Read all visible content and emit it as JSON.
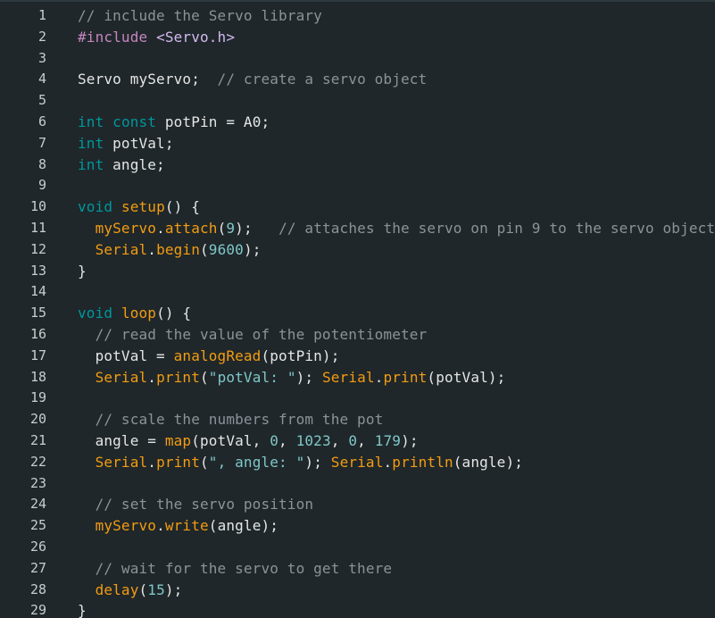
{
  "editor": {
    "lines": [
      {
        "n": "1",
        "tokens": [
          {
            "t": "// include the Servo library",
            "c": "comment"
          }
        ]
      },
      {
        "n": "2",
        "tokens": [
          {
            "t": "#include",
            "c": "pre"
          },
          {
            "t": " ",
            "c": "plain"
          },
          {
            "t": "<Servo.h>",
            "c": "hdr"
          }
        ]
      },
      {
        "n": "3",
        "tokens": []
      },
      {
        "n": "4",
        "tokens": [
          {
            "t": "Servo myServ",
            "c": "plain"
          },
          {
            "t": "o;  ",
            "c": "plain"
          },
          {
            "t": "// create a servo object",
            "c": "comment"
          }
        ]
      },
      {
        "n": "5",
        "tokens": []
      },
      {
        "n": "6",
        "tokens": [
          {
            "t": "int",
            "c": "type"
          },
          {
            "t": " ",
            "c": "plain"
          },
          {
            "t": "const",
            "c": "type"
          },
          {
            "t": " potPin = A0;",
            "c": "plain"
          }
        ]
      },
      {
        "n": "7",
        "tokens": [
          {
            "t": "int",
            "c": "type"
          },
          {
            "t": " potVal;",
            "c": "plain"
          }
        ]
      },
      {
        "n": "8",
        "tokens": [
          {
            "t": "int",
            "c": "type"
          },
          {
            "t": " angle;",
            "c": "plain"
          }
        ]
      },
      {
        "n": "9",
        "tokens": []
      },
      {
        "n": "10",
        "tokens": [
          {
            "t": "void",
            "c": "type"
          },
          {
            "t": " ",
            "c": "plain"
          },
          {
            "t": "setup",
            "c": "fn"
          },
          {
            "t": "() {",
            "c": "plain"
          }
        ]
      },
      {
        "n": "11",
        "tokens": [
          {
            "t": "  ",
            "c": "plain"
          },
          {
            "t": "myServo",
            "c": "fn"
          },
          {
            "t": ".",
            "c": "plain"
          },
          {
            "t": "attach",
            "c": "fn"
          },
          {
            "t": "(",
            "c": "plain"
          },
          {
            "t": "9",
            "c": "num"
          },
          {
            "t": ");   ",
            "c": "plain"
          },
          {
            "t": "// attaches the servo on pin 9 to the servo object",
            "c": "comment"
          }
        ]
      },
      {
        "n": "12",
        "tokens": [
          {
            "t": "  ",
            "c": "plain"
          },
          {
            "t": "Serial",
            "c": "fn"
          },
          {
            "t": ".",
            "c": "plain"
          },
          {
            "t": "begin",
            "c": "fn"
          },
          {
            "t": "(",
            "c": "plain"
          },
          {
            "t": "9600",
            "c": "num"
          },
          {
            "t": ");",
            "c": "plain"
          }
        ]
      },
      {
        "n": "13",
        "tokens": [
          {
            "t": "}",
            "c": "plain"
          }
        ]
      },
      {
        "n": "14",
        "tokens": []
      },
      {
        "n": "15",
        "tokens": [
          {
            "t": "void",
            "c": "type"
          },
          {
            "t": " ",
            "c": "plain"
          },
          {
            "t": "loop",
            "c": "fn"
          },
          {
            "t": "() {",
            "c": "plain"
          }
        ]
      },
      {
        "n": "16",
        "tokens": [
          {
            "t": "  ",
            "c": "plain"
          },
          {
            "t": "// read the value of the potentiometer",
            "c": "comment"
          }
        ]
      },
      {
        "n": "17",
        "tokens": [
          {
            "t": "  potVal = ",
            "c": "plain"
          },
          {
            "t": "analogRead",
            "c": "fn"
          },
          {
            "t": "(potPin);",
            "c": "plain"
          }
        ]
      },
      {
        "n": "18",
        "tokens": [
          {
            "t": "  ",
            "c": "plain"
          },
          {
            "t": "Serial",
            "c": "fn"
          },
          {
            "t": ".",
            "c": "plain"
          },
          {
            "t": "print",
            "c": "fn"
          },
          {
            "t": "(",
            "c": "plain"
          },
          {
            "t": "\"potVal: \"",
            "c": "str"
          },
          {
            "t": "); ",
            "c": "plain"
          },
          {
            "t": "Serial",
            "c": "fn"
          },
          {
            "t": ".",
            "c": "plain"
          },
          {
            "t": "print",
            "c": "fn"
          },
          {
            "t": "(potVal);",
            "c": "plain"
          }
        ]
      },
      {
        "n": "19",
        "tokens": []
      },
      {
        "n": "20",
        "tokens": [
          {
            "t": "  ",
            "c": "plain"
          },
          {
            "t": "// scale the numbers from the pot",
            "c": "comment"
          }
        ]
      },
      {
        "n": "21",
        "tokens": [
          {
            "t": "  angle = ",
            "c": "plain"
          },
          {
            "t": "map",
            "c": "fn"
          },
          {
            "t": "(potVal, ",
            "c": "plain"
          },
          {
            "t": "0",
            "c": "num"
          },
          {
            "t": ", ",
            "c": "plain"
          },
          {
            "t": "1023",
            "c": "num"
          },
          {
            "t": ", ",
            "c": "plain"
          },
          {
            "t": "0",
            "c": "num"
          },
          {
            "t": ", ",
            "c": "plain"
          },
          {
            "t": "179",
            "c": "num"
          },
          {
            "t": ");",
            "c": "plain"
          }
        ]
      },
      {
        "n": "22",
        "tokens": [
          {
            "t": "  ",
            "c": "plain"
          },
          {
            "t": "Serial",
            "c": "fn"
          },
          {
            "t": ".",
            "c": "plain"
          },
          {
            "t": "print",
            "c": "fn"
          },
          {
            "t": "(",
            "c": "plain"
          },
          {
            "t": "\", angle: \"",
            "c": "str"
          },
          {
            "t": "); ",
            "c": "plain"
          },
          {
            "t": "Serial",
            "c": "fn"
          },
          {
            "t": ".",
            "c": "plain"
          },
          {
            "t": "println",
            "c": "fn"
          },
          {
            "t": "(angle);",
            "c": "plain"
          }
        ]
      },
      {
        "n": "23",
        "tokens": []
      },
      {
        "n": "24",
        "tokens": [
          {
            "t": "  ",
            "c": "plain"
          },
          {
            "t": "// set the servo position",
            "c": "comment"
          }
        ]
      },
      {
        "n": "25",
        "tokens": [
          {
            "t": "  ",
            "c": "plain"
          },
          {
            "t": "myServo",
            "c": "fn"
          },
          {
            "t": ".",
            "c": "plain"
          },
          {
            "t": "write",
            "c": "fn"
          },
          {
            "t": "(angle);",
            "c": "plain"
          }
        ]
      },
      {
        "n": "26",
        "tokens": []
      },
      {
        "n": "27",
        "tokens": [
          {
            "t": "  ",
            "c": "plain"
          },
          {
            "t": "// wait for the servo to get there",
            "c": "comment"
          }
        ]
      },
      {
        "n": "28",
        "tokens": [
          {
            "t": "  ",
            "c": "plain"
          },
          {
            "t": "delay",
            "c": "fn"
          },
          {
            "t": "(",
            "c": "plain"
          },
          {
            "t": "15",
            "c": "num"
          },
          {
            "t": ");",
            "c": "plain"
          }
        ]
      },
      {
        "n": "29",
        "tokens": [
          {
            "t": "}",
            "c": "plain"
          }
        ]
      }
    ]
  }
}
